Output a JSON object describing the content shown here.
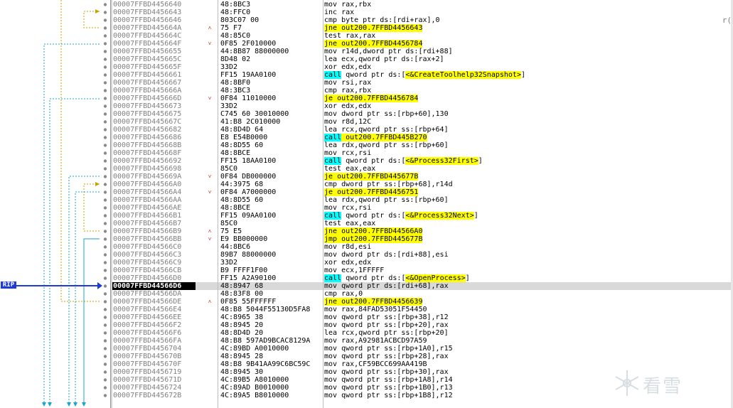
{
  "rip_label": "RIP",
  "right_fragment": "r(",
  "watermark_text": "看雪",
  "colors": {
    "highlight_yellow": "#ffff00",
    "highlight_cyan": "#00ffff",
    "rip_blue": "#1f3bd6",
    "current_row": "#d9d9d9"
  },
  "rows": [
    {
      "addr": "00007FFBD4456640",
      "bytes": "48:8BC3",
      "dis": "mov rax,rbx",
      "arrow": ""
    },
    {
      "addr": "00007FFBD4456643",
      "bytes": "48:FFC0",
      "dis": "inc rax",
      "arrow": ""
    },
    {
      "addr": "00007FFBD4456646",
      "bytes": "803C07 00",
      "dis": "cmp byte ptr ds:[rdi+rax],0",
      "arrow": ""
    },
    {
      "addr": "00007FFBD445664A",
      "bytes": "75 F7",
      "dis": "jne out200.7FFBD4456643",
      "arrow": "up",
      "hl": "y"
    },
    {
      "addr": "00007FFBD445664C",
      "bytes": "48:85C0",
      "dis": "test rax,rax",
      "arrow": ""
    },
    {
      "addr": "00007FFBD445664F",
      "bytes": "0F85 2F010000",
      "dis": "jne out200.7FFBD4456784",
      "arrow": "dn",
      "hl": "y"
    },
    {
      "addr": "00007FFBD4456655",
      "bytes": "44:8B87 88000000",
      "dis": "mov r14d,dword ptr ds:[rdi+88]",
      "arrow": ""
    },
    {
      "addr": "00007FFBD445665C",
      "bytes": "8D48 02",
      "dis": "lea ecx,qword ptr ds:[rax+2]",
      "arrow": ""
    },
    {
      "addr": "00007FFBD445665F",
      "bytes": "33D2",
      "dis": "xor edx,edx",
      "arrow": ""
    },
    {
      "addr": "00007FFBD4456661",
      "bytes": "FF15 19AA0100",
      "dis": "call qword ptr ds:[<&CreateToolhelp32Snapshot>]",
      "arrow": "",
      "hl": "call"
    },
    {
      "addr": "00007FFBD4456667",
      "bytes": "48:8BF0",
      "dis": "mov rsi,rax",
      "arrow": ""
    },
    {
      "addr": "00007FFBD445666A",
      "bytes": "48:3BC3",
      "dis": "cmp rax,rbx",
      "arrow": ""
    },
    {
      "addr": "00007FFBD445666D",
      "bytes": "0F84 11010000",
      "dis": "je out200.7FFBD4456784",
      "arrow": "dn",
      "hl": "y"
    },
    {
      "addr": "00007FFBD4456673",
      "bytes": "33D2",
      "dis": "xor edx,edx",
      "arrow": ""
    },
    {
      "addr": "00007FFBD4456675",
      "bytes": "C745 60 30010000",
      "dis": "mov dword ptr ss:[rbp+60],130",
      "arrow": ""
    },
    {
      "addr": "00007FFBD445667C",
      "bytes": "41:B8 2C010000",
      "dis": "mov r8d,12C",
      "arrow": ""
    },
    {
      "addr": "00007FFBD4456682",
      "bytes": "48:8D4D 64",
      "dis": "lea rcx,qword ptr ss:[rbp+64]",
      "arrow": ""
    },
    {
      "addr": "00007FFBD4456686",
      "bytes": "E8 E54B0000",
      "dis": "call out200.7FFBD445B270",
      "arrow": "",
      "hl": "callc"
    },
    {
      "addr": "00007FFBD445668B",
      "bytes": "48:8D55 60",
      "dis": "lea rdx,qword ptr ss:[rbp+60]",
      "arrow": ""
    },
    {
      "addr": "00007FFBD445668F",
      "bytes": "48:8BCE",
      "dis": "mov rcx,rsi",
      "arrow": ""
    },
    {
      "addr": "00007FFBD4456692",
      "bytes": "FF15 18AA0100",
      "dis": "call qword ptr ds:[<&Process32First>]",
      "arrow": "",
      "hl": "call"
    },
    {
      "addr": "00007FFBD4456698",
      "bytes": "85C0",
      "dis": "test eax,eax",
      "arrow": ""
    },
    {
      "addr": "00007FFBD445669A",
      "bytes": "0F84 DB000000",
      "dis": "je out200.7FFBD445677B",
      "arrow": "dn",
      "hl": "y"
    },
    {
      "addr": "00007FFBD44566A0",
      "bytes": "44:3975 68",
      "dis": "cmp dword ptr ss:[rbp+68],r14d",
      "arrow": ""
    },
    {
      "addr": "00007FFBD44566A4",
      "bytes": "0F84 A7000000",
      "dis": "je out200.7FFBD4456751",
      "arrow": "dn",
      "hl": "y"
    },
    {
      "addr": "00007FFBD44566AA",
      "bytes": "48:8D55 60",
      "dis": "lea rdx,qword ptr ss:[rbp+60]",
      "arrow": ""
    },
    {
      "addr": "00007FFBD44566AE",
      "bytes": "48:8BCE",
      "dis": "mov rcx,rsi",
      "arrow": ""
    },
    {
      "addr": "00007FFBD44566B1",
      "bytes": "FF15 09AA0100",
      "dis": "call qword ptr ds:[<&Process32Next>]",
      "arrow": "",
      "hl": "call"
    },
    {
      "addr": "00007FFBD44566B7",
      "bytes": "85C0",
      "dis": "test eax,eax",
      "arrow": ""
    },
    {
      "addr": "00007FFBD44566B9",
      "bytes": "75 E5",
      "dis": "jne out200.7FFBD44566A0",
      "arrow": "up",
      "hl": "y"
    },
    {
      "addr": "00007FFBD44566BB",
      "bytes": "E9 BB000000",
      "dis": "jmp out200.7FFBD445677B",
      "arrow": "dn",
      "hl": "y"
    },
    {
      "addr": "00007FFBD44566C0",
      "bytes": "44:8BC6",
      "dis": "mov r8d,esi",
      "arrow": ""
    },
    {
      "addr": "00007FFBD44566C3",
      "bytes": "89B7 88000000",
      "dis": "mov dword ptr ds:[rdi+88],esi",
      "arrow": ""
    },
    {
      "addr": "00007FFBD44566C9",
      "bytes": "33D2",
      "dis": "xor edx,edx",
      "arrow": ""
    },
    {
      "addr": "00007FFBD44566CB",
      "bytes": "B9 FFFF1F00",
      "dis": "mov ecx,1FFFFF",
      "arrow": ""
    },
    {
      "addr": "00007FFBD44566D0",
      "bytes": "FF15 A2A90100",
      "dis": "call qword ptr ds:[<&OpenProcess>]",
      "arrow": "",
      "hl": "call"
    },
    {
      "addr": "00007FFBD44566D6",
      "bytes": "48:8947 68",
      "dis": "mov qword ptr ds:[rdi+68],rax",
      "arrow": "",
      "cur": true
    },
    {
      "addr": "00007FFBD44566DA",
      "bytes": "48:83F8 00",
      "dis": "cmp rax,0",
      "arrow": ""
    },
    {
      "addr": "00007FFBD44566DE",
      "bytes": "0F85 55FFFFFF",
      "dis": "jne out200.7FFBD4456639",
      "arrow": "up",
      "hl": "y"
    },
    {
      "addr": "00007FFBD44566E4",
      "bytes": "48:B8 5044F55130D5FA8",
      "dis": "mov rax,84FAD53051F54450",
      "arrow": ""
    },
    {
      "addr": "00007FFBD44566EE",
      "bytes": "4C:8965 38",
      "dis": "mov qword ptr ss:[rbp+38],r12",
      "arrow": ""
    },
    {
      "addr": "00007FFBD44566F2",
      "bytes": "48:8945 20",
      "dis": "mov qword ptr ss:[rbp+20],rax",
      "arrow": ""
    },
    {
      "addr": "00007FFBD44566F6",
      "bytes": "48:8D4D 20",
      "dis": "lea rcx,qword ptr ss:[rbp+20]",
      "arrow": ""
    },
    {
      "addr": "00007FFBD44566FA",
      "bytes": "48:B8 597AD9BCAC8129A",
      "dis": "mov rax,A92981ACBCD97A59",
      "arrow": ""
    },
    {
      "addr": "00007FFBD4456704",
      "bytes": "4C:89BD A0010000",
      "dis": "mov qword ptr ss:[rbp+1A0],r15",
      "arrow": ""
    },
    {
      "addr": "00007FFBD445670B",
      "bytes": "48:8945 28",
      "dis": "mov qword ptr ss:[rbp+28],rax",
      "arrow": ""
    },
    {
      "addr": "00007FFBD445670F",
      "bytes": "48:B8 9B41AA99C6BC59C",
      "dis": "mov rax,CF59BCC699AA419B",
      "arrow": ""
    },
    {
      "addr": "00007FFBD4456719",
      "bytes": "48:8945 30",
      "dis": "mov qword ptr ss:[rbp+30],rax",
      "arrow": ""
    },
    {
      "addr": "00007FFBD445671D",
      "bytes": "4C:89B5 A8010000",
      "dis": "mov qword ptr ss:[rbp+1A8],r14",
      "arrow": ""
    },
    {
      "addr": "00007FFBD4456724",
      "bytes": "4C:89AD B0010000",
      "dis": "mov qword ptr ss:[rbp+1B0],r13",
      "arrow": ""
    },
    {
      "addr": "00007FFBD445672B",
      "bytes": "4C:89A5 B8010000",
      "dis": "mov qword ptr ss:[rbp+1B8],r12",
      "arrow": ""
    }
  ]
}
